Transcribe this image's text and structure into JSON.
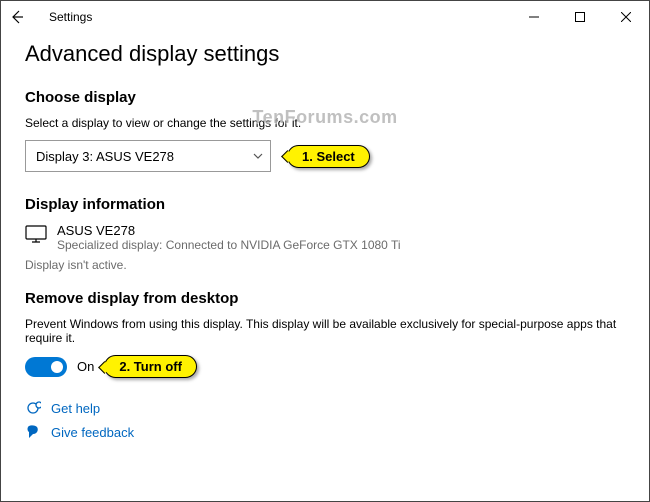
{
  "window": {
    "title": "Settings"
  },
  "page": {
    "heading": "Advanced display settings",
    "choose_display": {
      "title": "Choose display",
      "hint": "Select a display to view or change the settings for it.",
      "selected": "Display 3: ASUS VE278"
    },
    "display_info": {
      "title": "Display information",
      "name": "ASUS VE278",
      "detail": "Specialized display: Connected to NVIDIA GeForce GTX 1080 Ti",
      "status": "Display isn't active."
    },
    "remove": {
      "title": "Remove display from desktop",
      "desc": "Prevent Windows from using this display. This display will be available exclusively for special-purpose apps that require it.",
      "toggle_state": "On"
    },
    "links": {
      "help": "Get help",
      "feedback": "Give feedback"
    }
  },
  "callouts": {
    "select": "1.  Select",
    "turnoff": "2.  Turn off"
  },
  "watermark": "TenForums.com"
}
